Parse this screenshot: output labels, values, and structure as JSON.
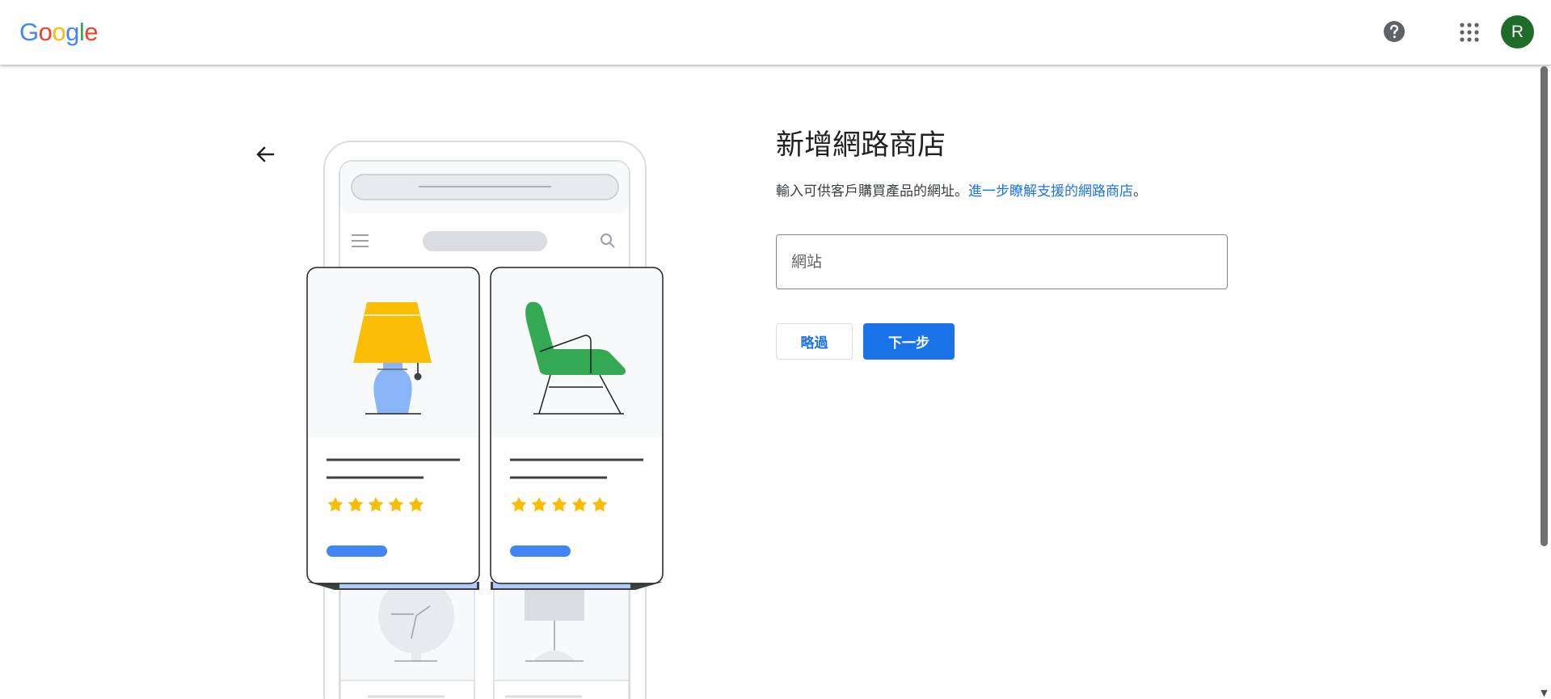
{
  "header": {
    "logo": {
      "letters": [
        "G",
        "o",
        "o",
        "g",
        "l",
        "e"
      ],
      "colors": [
        "#4285F4",
        "#EA4335",
        "#FBBC05",
        "#4285F4",
        "#34A853",
        "#EA4335"
      ]
    },
    "help_icon": "help-circle-icon",
    "apps_icon": "apps-grid-icon",
    "avatar_letter": "R",
    "avatar_color": "#1e6b2a"
  },
  "main": {
    "back_icon": "arrow-back-icon",
    "title": "新增網路商店",
    "description": "輸入可供客戶購買產品的網址。",
    "learn_more_link": "進一步瞭解支援的網路商店",
    "description_end": "。",
    "website_field": {
      "placeholder": "網站",
      "value": ""
    },
    "skip_button": "略過",
    "next_button": "下一步"
  },
  "illustration": {
    "products": [
      {
        "name": "lamp",
        "rating": 5
      },
      {
        "name": "chair",
        "rating": 5
      }
    ]
  },
  "colors": {
    "accent": "#1a73e8",
    "star": "#FBBC04"
  }
}
